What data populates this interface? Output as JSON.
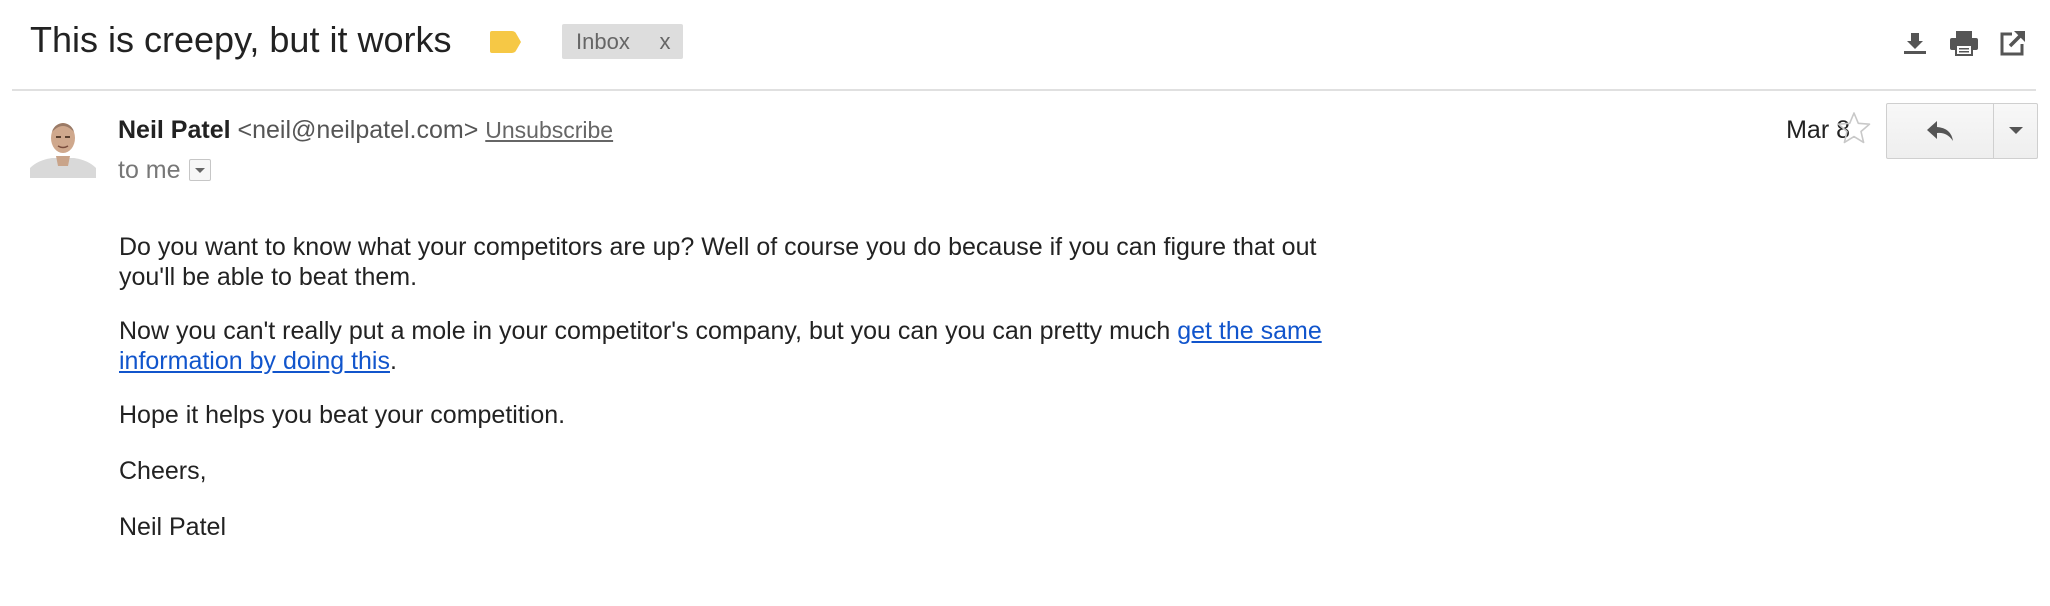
{
  "thread": {
    "subject": "This is creepy, but it works",
    "label": "Inbox",
    "label_remove": "x",
    "label_tag_color": "#f6c845",
    "actions": [
      {
        "icon": "download-icon"
      },
      {
        "icon": "print-icon"
      },
      {
        "icon": "open-new-window-icon"
      }
    ]
  },
  "message": {
    "sender_name": "Neil Patel",
    "sender_email": "<neil@neilpatel.com>",
    "unsubscribe": "Unsubscribe",
    "recipient": "to me",
    "date": "Mar 8",
    "star_icon": "star-outline-icon",
    "reply_icon": "reply-icon",
    "more_icon": "chevron-down-icon",
    "avatar_icon": "sender-avatar"
  },
  "body": {
    "p1": "Do you want to know what your competitors are up? Well of course you do because if you can figure that out you'll be able to beat them.",
    "p2_before": "Now you can't really put a mole in your competitor's company, but you can you can pretty much ",
    "p2_link": "get the same information by doing this",
    "p2_after": ".",
    "p3": "Hope it helps you beat your competition.",
    "p4": "Cheers,",
    "p5": "Neil Patel",
    "link_color": "#1155cc"
  }
}
